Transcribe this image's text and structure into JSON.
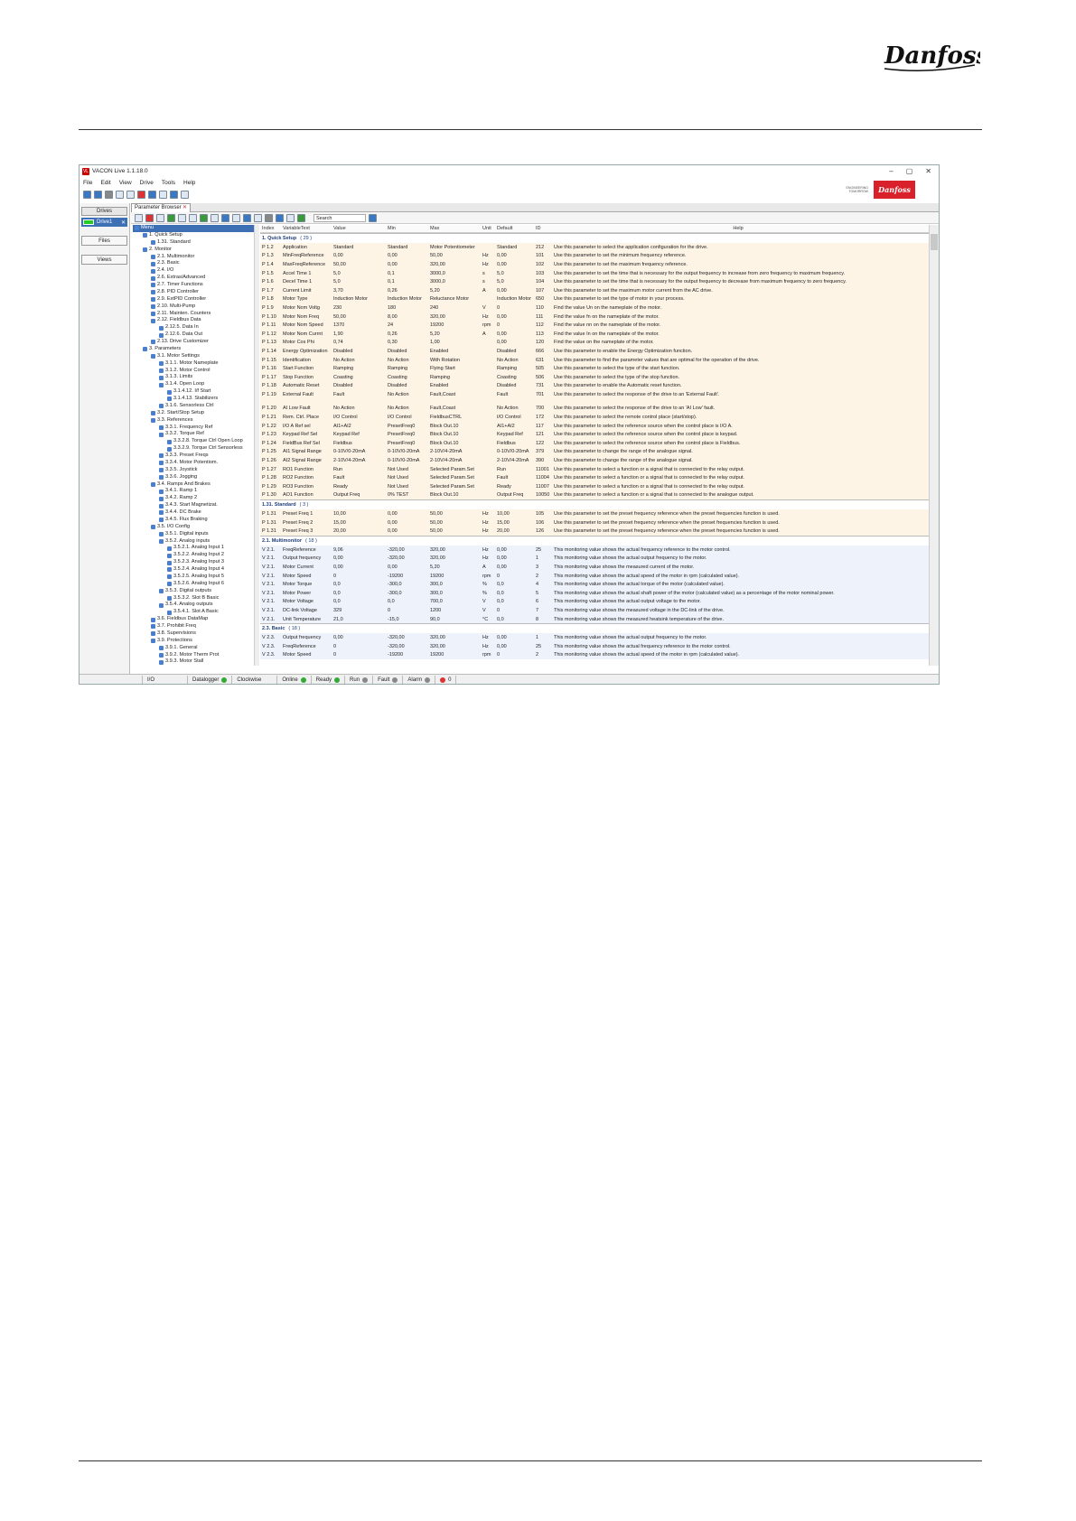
{
  "app": {
    "title": "VACON Live 1.1.18.0",
    "logo_text": "VL"
  },
  "menus": [
    "File",
    "Edit",
    "View",
    "Drive",
    "Tools",
    "Help"
  ],
  "brand": {
    "tagline1": "ENGINEERING",
    "tagline2": "TOMORROW",
    "logo": "Danfoss"
  },
  "sidebar": {
    "drives_tab": "Drives",
    "drive_name": "Drive1",
    "files_btn": "Files",
    "views_btn": "Views"
  },
  "param_browser": {
    "tab_label": "Parameter Browser",
    "search_placeholder": "Search"
  },
  "columns": {
    "index": "Index",
    "var": "VariableText",
    "value": "Value",
    "min": "Min",
    "max": "Max",
    "unit": "Unit",
    "default": "Default",
    "id": "ID",
    "help": "Help"
  },
  "tree": [
    {
      "label": "Menu",
      "level": 0,
      "sel": true
    },
    {
      "label": "1. Quick Setup",
      "level": 1
    },
    {
      "label": "1.31. Standard",
      "level": 2
    },
    {
      "label": "2. Monitor",
      "level": 1
    },
    {
      "label": "2.1. Multimonitor",
      "level": 2
    },
    {
      "label": "2.3. Basic",
      "level": 2
    },
    {
      "label": "2.4. I/O",
      "level": 2
    },
    {
      "label": "2.6. Extras/Advanced",
      "level": 2
    },
    {
      "label": "2.7. Timer Functions",
      "level": 2
    },
    {
      "label": "2.8. PID Controller",
      "level": 2
    },
    {
      "label": "2.9. ExtPID Controller",
      "level": 2
    },
    {
      "label": "2.10. Multi-Pump",
      "level": 2
    },
    {
      "label": "2.11. Mainten. Counters",
      "level": 2
    },
    {
      "label": "2.12. Fieldbus Data",
      "level": 2
    },
    {
      "label": "2.12.5. Data In",
      "level": 3
    },
    {
      "label": "2.12.6. Data Out",
      "level": 3
    },
    {
      "label": "2.13. Drive Customizer",
      "level": 2
    },
    {
      "label": "3. Parameters",
      "level": 1
    },
    {
      "label": "3.1. Motor Settings",
      "level": 2
    },
    {
      "label": "3.1.1. Motor Nameplate",
      "level": 3
    },
    {
      "label": "3.1.2. Motor Control",
      "level": 3
    },
    {
      "label": "3.1.3. Limits",
      "level": 3
    },
    {
      "label": "3.1.4. Open Loop",
      "level": 3
    },
    {
      "label": "3.1.4.12. I/f Start",
      "level": 4
    },
    {
      "label": "3.1.4.13. Stabilizers",
      "level": 4
    },
    {
      "label": "3.1.6. Sensorless Ctrl",
      "level": 3
    },
    {
      "label": "3.2. Start/Stop Setup",
      "level": 2
    },
    {
      "label": "3.3. References",
      "level": 2
    },
    {
      "label": "3.3.1. Frequency Ref",
      "level": 3
    },
    {
      "label": "3.3.2. Torque Ref",
      "level": 3
    },
    {
      "label": "3.3.2.8. Torque Ctrl Open Loop",
      "level": 4
    },
    {
      "label": "3.3.2.9. Torque Ctrl Sensorless",
      "level": 4
    },
    {
      "label": "3.3.3. Preset Freqs",
      "level": 3
    },
    {
      "label": "3.3.4. Motor Potentiom.",
      "level": 3
    },
    {
      "label": "3.3.5. Joystick",
      "level": 3
    },
    {
      "label": "3.3.6. Jogging",
      "level": 3
    },
    {
      "label": "3.4. Ramps And Brakes",
      "level": 2
    },
    {
      "label": "3.4.1. Ramp 1",
      "level": 3
    },
    {
      "label": "3.4.2. Ramp 2",
      "level": 3
    },
    {
      "label": "3.4.3. Start Magnetizat.",
      "level": 3
    },
    {
      "label": "3.4.4. DC Brake",
      "level": 3
    },
    {
      "label": "3.4.5. Flux Braking",
      "level": 3
    },
    {
      "label": "3.5. I/O Config",
      "level": 2
    },
    {
      "label": "3.5.1. Digital inputs",
      "level": 3
    },
    {
      "label": "3.5.2. Analog inputs",
      "level": 3
    },
    {
      "label": "3.5.2.1. Analog Input 1",
      "level": 4
    },
    {
      "label": "3.5.2.2. Analog Input 2",
      "level": 4
    },
    {
      "label": "3.5.2.3. Analog Input 3",
      "level": 4
    },
    {
      "label": "3.5.2.4. Analog Input 4",
      "level": 4
    },
    {
      "label": "3.5.2.5. Analog Input 5",
      "level": 4
    },
    {
      "label": "3.5.2.6. Analog Input 6",
      "level": 4
    },
    {
      "label": "3.5.3. Digital outputs",
      "level": 3
    },
    {
      "label": "3.5.3.2. Slot B Basic",
      "level": 4
    },
    {
      "label": "3.5.4. Analog outputs",
      "level": 3
    },
    {
      "label": "3.5.4.1. Slot A Basic",
      "level": 4
    },
    {
      "label": "3.6. Fieldbus DataMap",
      "level": 2
    },
    {
      "label": "3.7. Prohibit Freq",
      "level": 2
    },
    {
      "label": "3.8. Supervisions",
      "level": 2
    },
    {
      "label": "3.9. Protections",
      "level": 2
    },
    {
      "label": "3.9.1. General",
      "level": 3
    },
    {
      "label": "3.9.2. Motor Therm Prot",
      "level": 3
    },
    {
      "label": "3.9.3. Motor Stall",
      "level": 3
    }
  ],
  "rows": [
    {
      "t": "grp",
      "label": "1. Quick Setup",
      "count": "( 29 )"
    },
    {
      "t": "p",
      "c": [
        "P 1.2",
        "Application",
        "Standard",
        "Standard",
        "Motor Potentiometer",
        "",
        "Standard",
        "212",
        "Use this parameter to select the application configuration for the drive."
      ]
    },
    {
      "t": "p",
      "c": [
        "P 1.3",
        "MinFreqReference",
        "0,00",
        "0,00",
        "50,00",
        "Hz",
        "0,00",
        "101",
        "Use this parameter to set the minimum frequency reference."
      ]
    },
    {
      "t": "p",
      "c": [
        "P 1.4",
        "MaxFreqReference",
        "50,00",
        "0,00",
        "320,00",
        "Hz",
        "0,00",
        "102",
        "Use this parameter to set the maximum frequency reference."
      ]
    },
    {
      "t": "p",
      "c": [
        "P 1.5",
        "Accel Time 1",
        "5,0",
        "0,1",
        "3000,0",
        "s",
        "5,0",
        "103",
        "Use this parameter to set the time that is necessary for the output frequency to increase from zero frequency to maximum frequency."
      ]
    },
    {
      "t": "p",
      "c": [
        "P 1.6",
        "Decel Time 1",
        "5,0",
        "0,1",
        "3000,0",
        "s",
        "5,0",
        "104",
        "Use this parameter to set the time that is necessary for the output frequency to decrease from maximum frequency to zero frequency."
      ]
    },
    {
      "t": "p",
      "c": [
        "P 1.7",
        "Current Limit",
        "3,70",
        "0,26",
        "5,20",
        "A",
        "0,00",
        "107",
        "Use this parameter to set the maximum motor current from the AC drive."
      ]
    },
    {
      "t": "p",
      "c": [
        "P 1.8",
        "Motor Type",
        "Induction Motor",
        "Induction Motor",
        "Reluctance Motor",
        "",
        "Induction Motor",
        "650",
        "Use this parameter to set the type of motor in your process."
      ]
    },
    {
      "t": "p",
      "c": [
        "P 1.9",
        "Motor Nom Voltg",
        "230",
        "180",
        "240",
        "V",
        "0",
        "110",
        "Find the value Un on the nameplate of the motor."
      ]
    },
    {
      "t": "p",
      "c": [
        "P 1.10",
        "Motor Nom Freq",
        "50,00",
        "8,00",
        "320,00",
        "Hz",
        "0,00",
        "111",
        "Find the value fn on the nameplate of the motor."
      ]
    },
    {
      "t": "p",
      "c": [
        "P 1.11",
        "Motor Nom Speed",
        "1370",
        "24",
        "19200",
        "rpm",
        "0",
        "112",
        "Find the value nn on the nameplate of the motor."
      ]
    },
    {
      "t": "p",
      "c": [
        "P 1.12",
        "Motor Nom Currnt",
        "1,90",
        "0,26",
        "5,20",
        "A",
        "0,00",
        "113",
        "Find the value In on the nameplate of the motor."
      ]
    },
    {
      "t": "p",
      "c": [
        "P 1.13",
        "Motor Cos Phi",
        "0,74",
        "0,30",
        "1,00",
        "",
        "0,00",
        "120",
        "Find the value on the nameplate of the motor."
      ]
    },
    {
      "t": "p",
      "c": [
        "P 1.14",
        "Energy Optimization",
        "Disabled",
        "Disabled",
        "Enabled",
        "",
        "Disabled",
        "666",
        "Use this parameter to enable the Energy Optimization function."
      ]
    },
    {
      "t": "p",
      "c": [
        "P 1.15",
        "Identification",
        "No Action",
        "No Action",
        "With Rotation",
        "",
        "No Action",
        "631",
        "Use this parameter to find the parameter values that are optimal for the operation of the drive."
      ]
    },
    {
      "t": "p",
      "c": [
        "P 1.16",
        "Start Function",
        "Ramping",
        "Ramping",
        "Flying Start",
        "",
        "Ramping",
        "505",
        "Use this parameter to select the type of the start function."
      ]
    },
    {
      "t": "p",
      "c": [
        "P 1.17",
        "Stop Function",
        "Coasting",
        "Coasting",
        "Ramping",
        "",
        "Coasting",
        "506",
        "Use this parameter to select the type of the stop function."
      ]
    },
    {
      "t": "p",
      "c": [
        "P 1.18",
        "Automatic Reset",
        "Disabled",
        "Disabled",
        "Enabled",
        "",
        "Disabled",
        "731",
        "Use this parameter to enable the Automatic reset function."
      ]
    },
    {
      "t": "p",
      "c": [
        "P 1.19",
        "External Fault",
        "Fault",
        "No Action",
        "Fault,Coast",
        "",
        "Fault",
        "701",
        "Use this parameter to select the response of the drive to an 'External Fault'."
      ]
    },
    {
      "t": "blank"
    },
    {
      "t": "p",
      "c": [
        "P 1.20",
        "AI Low Fault",
        "No Action",
        "No Action",
        "Fault,Coast",
        "",
        "No Action",
        "700",
        "Use this parameter to select the response of the drive to an 'AI Low' fault."
      ]
    },
    {
      "t": "p",
      "c": [
        "P 1.21",
        "Rem. Ctrl. Place",
        "I/O Control",
        "I/O Control",
        "FieldbusCTRL",
        "",
        "I/O Control",
        "172",
        "Use this parameter to select the remote control place (start/stop)."
      ]
    },
    {
      "t": "p",
      "c": [
        "P 1.22",
        "I/O A Ref sel",
        "AI1+AI2",
        "PresetFreq0",
        "Block Out.10",
        "",
        "AI1+AI2",
        "117",
        "Use this parameter to select the reference source when the control place is I/O A."
      ]
    },
    {
      "t": "p",
      "c": [
        "P 1.23",
        "Keypad Ref Sel",
        "Keypad Ref",
        "PresetFreq0",
        "Block Out.10",
        "",
        "Keypad Ref",
        "121",
        "Use this parameter to select the reference source when the control place is keypad."
      ]
    },
    {
      "t": "p",
      "c": [
        "P 1.24",
        "FieldBus Ref Sel",
        "Fieldbus",
        "PresetFreq0",
        "Block Out.10",
        "",
        "Fieldbus",
        "122",
        "Use this parameter to select the reference source when the control place is Fieldbus."
      ]
    },
    {
      "t": "p",
      "c": [
        "P 1.25",
        "AI1 Signal Range",
        "0-10V/0-20mA",
        "0-10V/0-20mA",
        "2-10V/4-20mA",
        "",
        "0-10V/0-20mA",
        "379",
        "Use this parameter to change the range of the analogue signal."
      ]
    },
    {
      "t": "p",
      "c": [
        "P 1.26",
        "AI2 Signal Range",
        "2-10V/4-20mA",
        "0-10V/0-20mA",
        "2-10V/4-20mA",
        "",
        "2-10V/4-20mA",
        "390",
        "Use this parameter to change the range of the analogue signal."
      ]
    },
    {
      "t": "p",
      "c": [
        "P 1.27",
        "RO1 Function",
        "Run",
        "Not Used",
        "Selected Param.Set",
        "",
        "Run",
        "11001",
        "Use this parameter to select a function or a signal that is connected to the relay output."
      ]
    },
    {
      "t": "p",
      "c": [
        "P 1.28",
        "RO2 Function",
        "Fault",
        "Not Used",
        "Selected Param.Set",
        "",
        "Fault",
        "11004",
        "Use this parameter to select a function or a signal that is connected to the relay output."
      ]
    },
    {
      "t": "p",
      "c": [
        "P 1.29",
        "RO3 Function",
        "Ready",
        "Not Used",
        "Selected Param.Set",
        "",
        "Ready",
        "11007",
        "Use this parameter to select a function or a signal that is connected to the relay output."
      ]
    },
    {
      "t": "p",
      "c": [
        "P 1.30",
        "AO1 Function",
        "Output Freq",
        "0% TEST",
        "Block Out.10",
        "",
        "Output Freq",
        "10050",
        "Use this parameter to select a function or a signal that is connected to the analogue output."
      ]
    },
    {
      "t": "grp",
      "label": "1.31. Standard",
      "count": "( 3 )"
    },
    {
      "t": "p",
      "c": [
        "P 1.31",
        "Preset Freq 1",
        "10,00",
        "0,00",
        "50,00",
        "Hz",
        "10,00",
        "105",
        "Use this parameter to set the preset frequency reference when the preset frequencies function is used."
      ]
    },
    {
      "t": "p",
      "c": [
        "P 1.31",
        "Preset Freq 2",
        "15,00",
        "0,00",
        "50,00",
        "Hz",
        "15,00",
        "106",
        "Use this parameter to set the preset frequency reference when the preset frequencies function is used."
      ]
    },
    {
      "t": "p",
      "c": [
        "P 1.31",
        "Preset Freq 3",
        "20,00",
        "0,00",
        "50,00",
        "Hz",
        "20,00",
        "126",
        "Use this parameter to set the preset frequency reference when the preset frequencies function is used."
      ]
    },
    {
      "t": "grp",
      "label": "2.1. Multimonitor",
      "count": "( 18 )"
    },
    {
      "t": "v",
      "c": [
        "V 2.1.",
        "FreqReference",
        "9,06",
        "-320,00",
        "320,00",
        "Hz",
        "0,00",
        "25",
        "This monitoring value shows the actual frequency reference to the motor control."
      ]
    },
    {
      "t": "v",
      "c": [
        "V 2.1.",
        "Output frequency",
        "0,00",
        "-320,00",
        "320,00",
        "Hz",
        "0,00",
        "1",
        "This monitoring value shows the actual output frequency to the motor."
      ]
    },
    {
      "t": "v",
      "c": [
        "V 2.1.",
        "Motor Current",
        "0,00",
        "0,00",
        "5,20",
        "A",
        "0,00",
        "3",
        "This monitoring value shows the measured current of the motor."
      ]
    },
    {
      "t": "v",
      "c": [
        "V 2.1.",
        "Motor Speed",
        "0",
        "-19200",
        "19200",
        "rpm",
        "0",
        "2",
        "This monitoring value shows the actual speed of the motor in rpm (calculated value)."
      ]
    },
    {
      "t": "v",
      "c": [
        "V 2.1.",
        "Motor Torque",
        "0,0",
        "-300,0",
        "300,0",
        "%",
        "0,0",
        "4",
        "This monitoring value shows the actual torque of the motor (calculated value)."
      ]
    },
    {
      "t": "v",
      "c": [
        "V 2.1.",
        "Motor Power",
        "0,0",
        "-300,0",
        "300,0",
        "%",
        "0,0",
        "5",
        "This monitoring value shows the actual shaft power of the motor (calculated value) as a percentage of the motor nominal power."
      ]
    },
    {
      "t": "v",
      "c": [
        "V 2.1.",
        "Motor Voltage",
        "0,0",
        "0,0",
        "700,0",
        "V",
        "0,0",
        "6",
        "This monitoring value shows the actual output voltage to the motor."
      ]
    },
    {
      "t": "v",
      "c": [
        "V 2.1.",
        "DC-link Voltage",
        "329",
        "0",
        "1200",
        "V",
        "0",
        "7",
        "This monitoring value shows the measured voltage in the DC-link of the drive."
      ]
    },
    {
      "t": "v",
      "c": [
        "V 2.1.",
        "Unit Temperature",
        "21,0",
        "-15,0",
        "90,0",
        "°C",
        "0,0",
        "8",
        "This monitoring value shows the measured heatsink temperature of the drive."
      ]
    },
    {
      "t": "grp",
      "label": "2.3. Basic",
      "count": "( 18 )"
    },
    {
      "t": "v",
      "c": [
        "V 2.3.",
        "Output frequency",
        "0,00",
        "-320,00",
        "320,00",
        "Hz",
        "0,00",
        "1",
        "This monitoring value shows the actual output frequency to the motor."
      ]
    },
    {
      "t": "v",
      "c": [
        "V 2.3.",
        "FreqReference",
        "0",
        "-320,00",
        "320,00",
        "Hz",
        "0,00",
        "25",
        "This monitoring value shows the actual frequency reference to the motor control."
      ]
    },
    {
      "t": "v",
      "c": [
        "V 2.3.",
        "Motor Speed",
        "0",
        "-19200",
        "19200",
        "rpm",
        "0",
        "2",
        "This monitoring value shows the actual speed of the motor in rpm (calculated value)."
      ]
    }
  ],
  "status": {
    "io": "I/O",
    "datalogger": "Datalogger",
    "direction": "Clockwise",
    "online": "Online",
    "ready": "Ready",
    "run": "Run",
    "fault": "Fault",
    "alarm": "Alarm",
    "count": "0"
  }
}
